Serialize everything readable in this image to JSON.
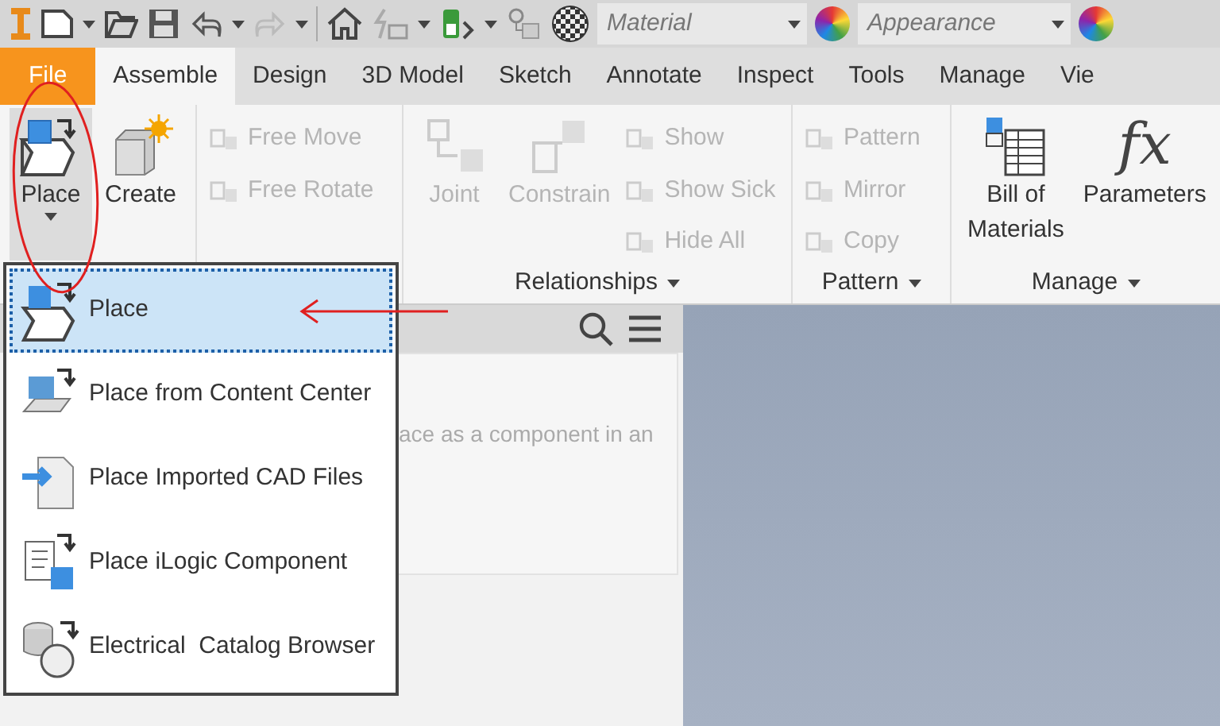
{
  "quick_access": {
    "fields": [
      {
        "value": "Material"
      },
      {
        "value": "Appearance"
      }
    ]
  },
  "tabs": [
    {
      "label": "File",
      "kind": "app",
      "selected": false
    },
    {
      "label": "Assemble",
      "kind": "tab",
      "selected": true
    },
    {
      "label": "Design",
      "kind": "tab",
      "selected": false
    },
    {
      "label": "3D Model",
      "kind": "tab",
      "selected": false
    },
    {
      "label": "Sketch",
      "kind": "tab",
      "selected": false
    },
    {
      "label": "Annotate",
      "kind": "tab",
      "selected": false
    },
    {
      "label": "Inspect",
      "kind": "tab",
      "selected": false
    },
    {
      "label": "Tools",
      "kind": "tab",
      "selected": false
    },
    {
      "label": "Manage",
      "kind": "tab",
      "selected": false
    },
    {
      "label": "Vie",
      "kind": "tab",
      "selected": false
    }
  ],
  "ribbon": {
    "panels": [
      {
        "tools": [
          {
            "kind": "large",
            "label": "Place",
            "pressed": true,
            "dropdown": true,
            "disabled": false
          },
          {
            "kind": "large",
            "label": "Create",
            "pressed": false,
            "dropdown": false,
            "disabled": false
          }
        ]
      },
      {
        "tools": [
          {
            "kind": "stack",
            "items": [
              {
                "label": "Free Move",
                "disabled": true
              },
              {
                "label": "Free Rotate",
                "disabled": true
              }
            ]
          }
        ]
      },
      {
        "label": "Relationships",
        "dropdown": true,
        "tools": [
          {
            "kind": "large",
            "label": "Joint",
            "pressed": false,
            "dropdown": false,
            "disabled": true
          },
          {
            "kind": "large",
            "label": "Constrain",
            "pressed": false,
            "dropdown": false,
            "disabled": true
          },
          {
            "kind": "stack",
            "items": [
              {
                "label": "Show",
                "disabled": true
              },
              {
                "label": "Show Sick",
                "disabled": true
              },
              {
                "label": "Hide All",
                "disabled": true
              }
            ]
          }
        ]
      },
      {
        "label": "Pattern",
        "dropdown": true,
        "tools": [
          {
            "kind": "stack",
            "items": [
              {
                "label": "Pattern",
                "disabled": true
              },
              {
                "label": "Mirror",
                "disabled": true
              },
              {
                "label": "Copy",
                "disabled": true
              }
            ]
          }
        ]
      },
      {
        "label": "Manage",
        "dropdown": true,
        "tools": [
          {
            "kind": "large",
            "label": "Bill of Materials",
            "pressed": false,
            "dropdown": false,
            "disabled": false
          },
          {
            "kind": "large",
            "label": "Parameters",
            "glyph": "fx",
            "pressed": false,
            "dropdown": false,
            "disabled": false
          }
        ]
      }
    ]
  },
  "menu": {
    "items": [
      {
        "label": "Place",
        "selected": true
      },
      {
        "label": "Place from Content Center",
        "selected": false
      },
      {
        "label": "Place Imported CAD Files",
        "selected": false
      },
      {
        "label": "Place iLogic Component",
        "selected": false
      },
      {
        "label": "Electrical  Catalog Browser",
        "selected": false
      }
    ]
  },
  "browser": {
    "tooltip": "ace as a component in an"
  }
}
